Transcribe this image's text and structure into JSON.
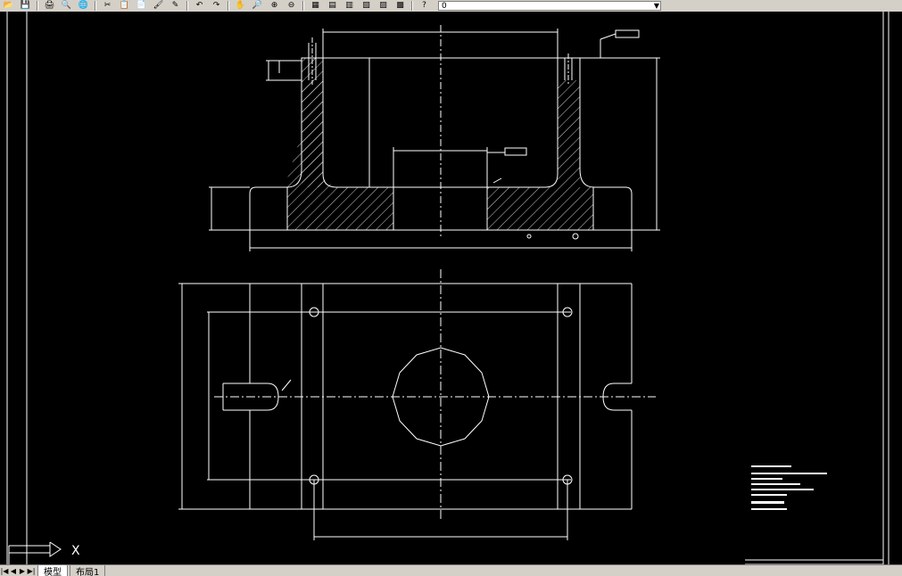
{
  "toolbar": {
    "buttons": [
      {
        "name": "open-icon",
        "glyph": "📂"
      },
      {
        "name": "save-icon",
        "glyph": "💾"
      },
      {
        "name": "print-icon",
        "glyph": "🖨"
      },
      {
        "name": "plot-preview-icon",
        "glyph": "🔍"
      },
      {
        "name": "publish-icon",
        "glyph": "🌐"
      },
      {
        "name": "cut-icon",
        "glyph": "✂"
      },
      {
        "name": "copy-icon",
        "glyph": "📋"
      },
      {
        "name": "paste-icon",
        "glyph": "📄"
      },
      {
        "name": "match-properties-icon",
        "glyph": "🖌"
      },
      {
        "name": "block-editor-icon",
        "glyph": "✎"
      },
      {
        "name": "undo-icon",
        "glyph": "↶"
      },
      {
        "name": "redo-icon",
        "glyph": "↷"
      },
      {
        "name": "pan-icon",
        "glyph": "✋"
      },
      {
        "name": "zoom-realtime-icon",
        "glyph": "🔎"
      },
      {
        "name": "zoom-window-icon",
        "glyph": "⊕"
      },
      {
        "name": "zoom-previous-icon",
        "glyph": "⊖"
      },
      {
        "name": "properties-icon",
        "glyph": "▦"
      },
      {
        "name": "design-center-icon",
        "glyph": "▤"
      },
      {
        "name": "tool-palettes-icon",
        "glyph": "▥"
      },
      {
        "name": "sheet-set-icon",
        "glyph": "▧"
      },
      {
        "name": "markup-icon",
        "glyph": "▨"
      },
      {
        "name": "calculator-icon",
        "glyph": "▩"
      },
      {
        "name": "help-icon",
        "glyph": "?"
      }
    ],
    "layer": {
      "current": "0"
    }
  },
  "ucs": {
    "x_label": "X"
  },
  "layout_tabs": {
    "nav": [
      "|◀",
      "◀",
      "▶",
      "▶|"
    ],
    "tabs": [
      {
        "label": "模型",
        "active": true
      },
      {
        "label": "布局1",
        "active": false
      }
    ]
  },
  "colors": {
    "background": "#000000",
    "line": "#ffffff",
    "hatch": "#ffffff"
  }
}
